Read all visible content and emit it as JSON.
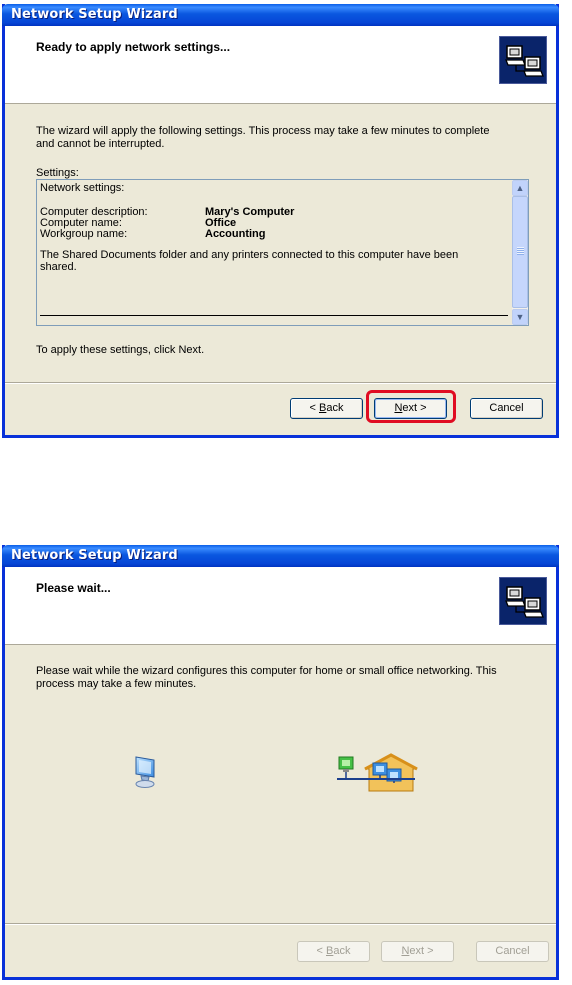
{
  "window1": {
    "title": "Network Setup Wizard",
    "header_title": "Ready to apply network settings...",
    "intro_line1": "The wizard will apply the following settings. This process may take a few minutes to complete",
    "intro_line2": "and cannot be interrupted.",
    "settings_label": "Settings:",
    "settings": {
      "heading": "Network settings:",
      "rows": [
        {
          "key": "Computer description:",
          "value": "Mary's Computer"
        },
        {
          "key": "Computer name:",
          "value": "Office"
        },
        {
          "key": "Workgroup name:",
          "value": "Accounting"
        }
      ],
      "shared_line1": "The Shared Documents folder and any printers connected to this computer have been",
      "shared_line2": "shared."
    },
    "apply_note": "To apply these settings, click Next.",
    "buttons": {
      "back_prefix": "< ",
      "back_key": "B",
      "back_rest": "ack",
      "next_key": "N",
      "next_rest": "ext >",
      "cancel": "Cancel"
    },
    "highlight_color": "#e00c22"
  },
  "window2": {
    "title": "Network Setup Wizard",
    "header_title": "Please wait...",
    "intro_line1": "Please wait while the wizard configures this computer for home or small office networking. This",
    "intro_line2": "process may take a few minutes.",
    "icons": [
      "computer-icon",
      "network-home-icon"
    ],
    "buttons": {
      "back_prefix": "< ",
      "back_key": "B",
      "back_rest": "ack",
      "next_key": "N",
      "next_rest": "ext >",
      "cancel": "Cancel"
    }
  },
  "colors": {
    "titlebar": "#0a5ee8",
    "window_bg": "#ece9d8",
    "border": "#0831d9"
  }
}
